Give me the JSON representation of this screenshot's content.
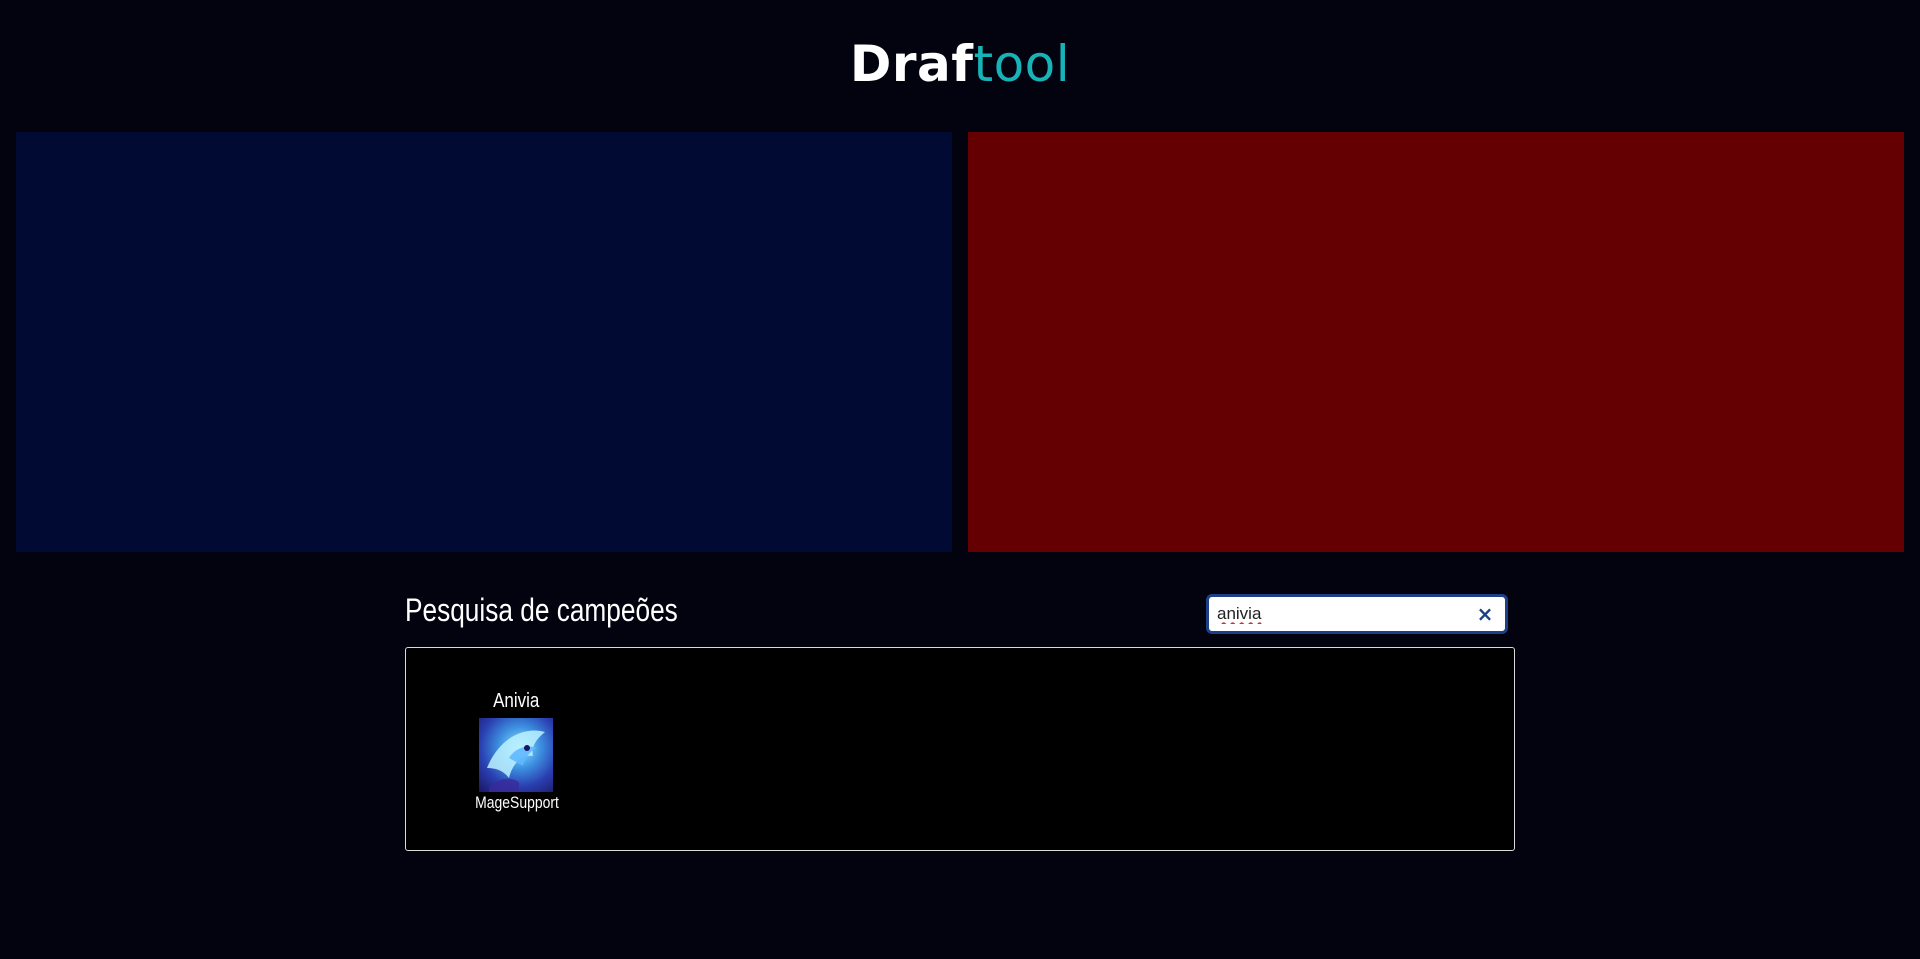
{
  "header": {
    "logo_bold": "Draf",
    "logo_light": "tool"
  },
  "teams": {
    "blue": {
      "color": "#000a33"
    },
    "red": {
      "color": "#650002"
    }
  },
  "search": {
    "title": "Pesquisa de campeões",
    "value": "anivia",
    "clear_icon": "×"
  },
  "results": [
    {
      "name": "Anivia",
      "tags": "MageSupport",
      "portrait_icon": "anivia-portrait"
    }
  ]
}
